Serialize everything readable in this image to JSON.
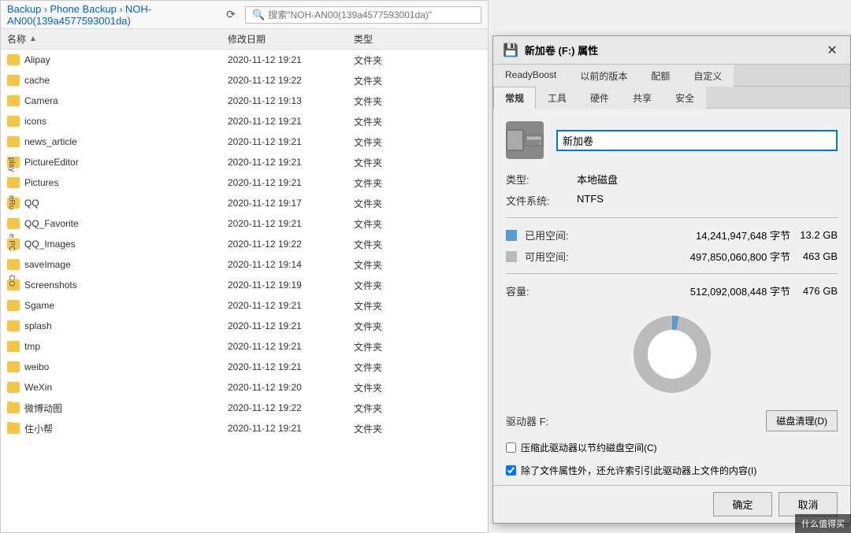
{
  "breadcrumb": {
    "parts": [
      "Backup",
      "Phone Backup",
      "NOH-AN00(139a4577593001da)"
    ],
    "separator": "›"
  },
  "search": {
    "placeholder": "搜索\"NOH-AN00(139a4577593001da)\""
  },
  "file_list": {
    "columns": {
      "name": "名称",
      "date": "修改日期",
      "type": "类型"
    },
    "sort_icon": "▲",
    "items": [
      {
        "name": "Alipay",
        "date": "2020-11-12 19:21",
        "type": "文件夹"
      },
      {
        "name": "cache",
        "date": "2020-11-12 19:22",
        "type": "文件夹"
      },
      {
        "name": "Camera",
        "date": "2020-11-12 19:13",
        "type": "文件夹"
      },
      {
        "name": "icons",
        "date": "2020-11-12 19:21",
        "type": "文件夹"
      },
      {
        "name": "news_article",
        "date": "2020-11-12 19:21",
        "type": "文件夹"
      },
      {
        "name": "PictureEditor",
        "date": "2020-11-12 19:21",
        "type": "文件夹"
      },
      {
        "name": "Pictures",
        "date": "2020-11-12 19:21",
        "type": "文件夹"
      },
      {
        "name": "QQ",
        "date": "2020-11-12 19:17",
        "type": "文件夹"
      },
      {
        "name": "QQ_Favorite",
        "date": "2020-11-12 19:21",
        "type": "文件夹"
      },
      {
        "name": "QQ_Images",
        "date": "2020-11-12 19:22",
        "type": "文件夹"
      },
      {
        "name": "saveImage",
        "date": "2020-11-12 19:14",
        "type": "文件夹"
      },
      {
        "name": "Screenshots",
        "date": "2020-11-12 19:19",
        "type": "文件夹"
      },
      {
        "name": "Sgame",
        "date": "2020-11-12 19:21",
        "type": "文件夹"
      },
      {
        "name": "splash",
        "date": "2020-11-12 19:21",
        "type": "文件夹"
      },
      {
        "name": "tmp",
        "date": "2020-11-12 19:21",
        "type": "文件夹"
      },
      {
        "name": "weibo",
        "date": "2020-11-12 19:21",
        "type": "文件夹"
      },
      {
        "name": "WeXin",
        "date": "2020-11-12 19:20",
        "type": "文件夹"
      },
      {
        "name": "微博动图",
        "date": "2020-11-12 19:22",
        "type": "文件夹"
      },
      {
        "name": "住小帮",
        "date": "2020-11-12 19:21",
        "type": "文件夹"
      }
    ]
  },
  "dialog": {
    "title": "新加卷 (F:) 属性",
    "drive_icon": "💾",
    "close_label": "✕",
    "tabs": {
      "row1": [
        "ReadyBoost",
        "以前的版本",
        "配额",
        "自定义"
      ],
      "row2": [
        "常规",
        "工具",
        "硬件",
        "共享",
        "安全"
      ]
    },
    "active_tab": "常规",
    "drive_name": "新加卷",
    "type_label": "类型:",
    "type_value": "本地磁盘",
    "fs_label": "文件系统:",
    "fs_value": "NTFS",
    "used_label": "已用空间:",
    "used_bytes": "14,241,947,648 字节",
    "used_gb": "13.2 GB",
    "free_label": "可用空间:",
    "free_bytes": "497,850,060,800 字节",
    "free_gb": "463 GB",
    "capacity_label": "容量:",
    "capacity_bytes": "512,092,008,448 字节",
    "capacity_gb": "476 GB",
    "drive_letter_label": "驱动器 F:",
    "cleanup_btn": "磁盘清理(D)",
    "compress_label": "压缩此驱动器以节约磁盘空间(C)",
    "index_label": "除了文件属性外，还允许索引引此驱动器上文件的内容(I)",
    "compress_checked": false,
    "index_checked": true,
    "ok_btn": "确定",
    "cancel_btn": "取消",
    "donut": {
      "used_pct": 2.78,
      "free_pct": 97.22,
      "used_color": "#5b9bd5",
      "free_color": "#bbb"
    }
  },
  "sidebar_labels": [
    "play",
    "eRu",
    "e PC",
    "CO"
  ],
  "watermark": "什么值得买"
}
